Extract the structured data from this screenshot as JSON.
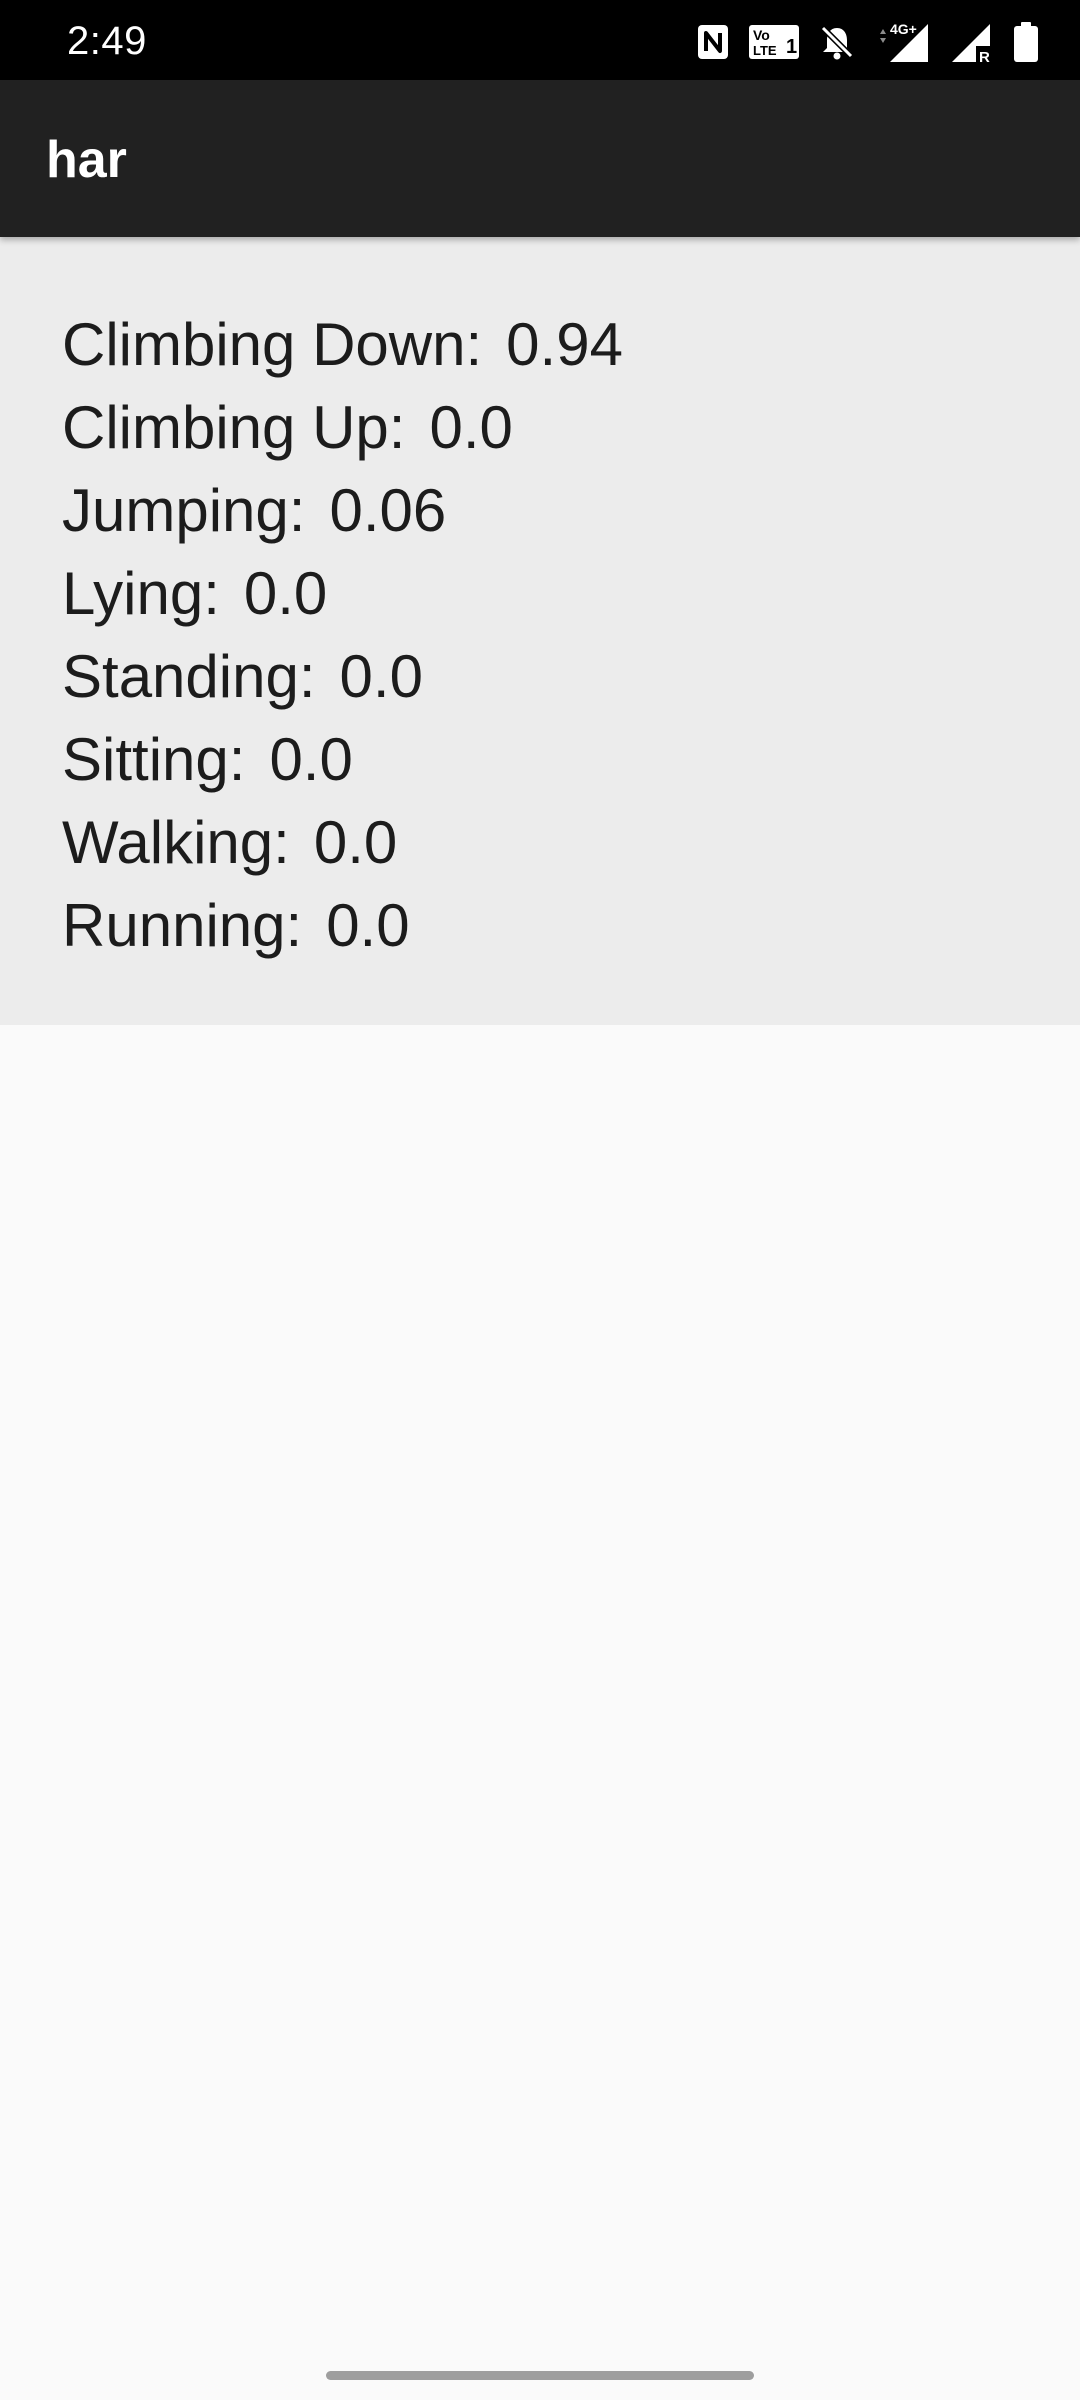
{
  "status_bar": {
    "time": "2:49",
    "icons": [
      "nfc-icon",
      "volte-icon",
      "bell-off-icon",
      "signal-4g-icon",
      "signal-roaming-icon",
      "battery-icon"
    ],
    "network_label": "4G+",
    "roaming_label": "R",
    "volte_label_top": "Vo",
    "volte_label_bottom": "LTE",
    "volte_sim": "1"
  },
  "app_bar": {
    "title": "har"
  },
  "results": [
    {
      "label": "Climbing Down:",
      "value": "0.94"
    },
    {
      "label": "Climbing Up:",
      "value": "0.0"
    },
    {
      "label": "Jumping:",
      "value": "0.06"
    },
    {
      "label": "Lying:",
      "value": "0.0"
    },
    {
      "label": "Standing:",
      "value": "0.0"
    },
    {
      "label": "Sitting:",
      "value": "0.0"
    },
    {
      "label": "Walking:",
      "value": "0.0"
    },
    {
      "label": "Running:",
      "value": "0.0"
    }
  ],
  "colors": {
    "status_bar": "#000000",
    "app_bar": "#212121",
    "panel": "#ececec",
    "background": "#fafafa"
  }
}
